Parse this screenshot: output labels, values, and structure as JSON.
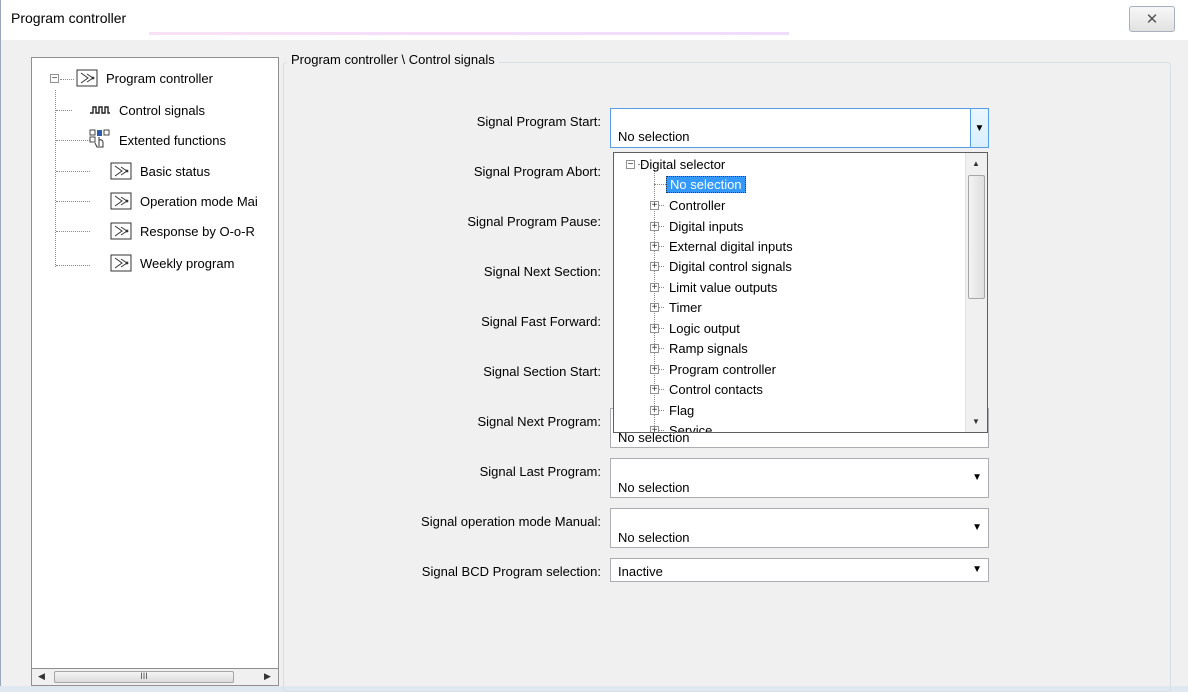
{
  "window": {
    "title": "Program controller",
    "close_glyph": "✕"
  },
  "tree": {
    "root_label": "Program controller",
    "items": [
      {
        "label": "Control signals",
        "icon": "pulse-signal-icon"
      },
      {
        "label": "Extented functions",
        "icon": "hand-pointer-icon"
      },
      {
        "label": "Basic status",
        "icon": "program-controller-icon"
      },
      {
        "label": "Operation mode Mai",
        "icon": "program-controller-icon"
      },
      {
        "label": "Response by O-o-R",
        "icon": "program-controller-icon"
      },
      {
        "label": "Weekly program",
        "icon": "program-controller-icon"
      }
    ],
    "scroll_grip": "III"
  },
  "panel": {
    "title": "Program controller \\ Control signals",
    "fields": [
      {
        "label": "Signal Program Start:",
        "value": "No selection"
      },
      {
        "label": "Signal Program Abort:",
        "value": ""
      },
      {
        "label": "Signal Program Pause:",
        "value": ""
      },
      {
        "label": "Signal Next Section:",
        "value": ""
      },
      {
        "label": "Signal Fast Forward:",
        "value": ""
      },
      {
        "label": "Signal Section Start:",
        "value": ""
      },
      {
        "label": "Signal Next Program:",
        "value": "No selection"
      },
      {
        "label": "Signal Last Program:",
        "value": "No selection"
      },
      {
        "label": "Signal operation mode Manual:",
        "value": "No selection"
      },
      {
        "label": "Signal BCD Program selection:",
        "value": "Inactive"
      }
    ]
  },
  "dropdown": {
    "root": "Digital selector",
    "selected": "No selection",
    "groups": [
      "Controller",
      "Digital inputs",
      "External digital inputs",
      "Digital control signals",
      "Limit value outputs",
      "Timer",
      "Logic output",
      "Ramp signals",
      "Program controller",
      "Control contacts",
      "Flag",
      "Service"
    ]
  }
}
